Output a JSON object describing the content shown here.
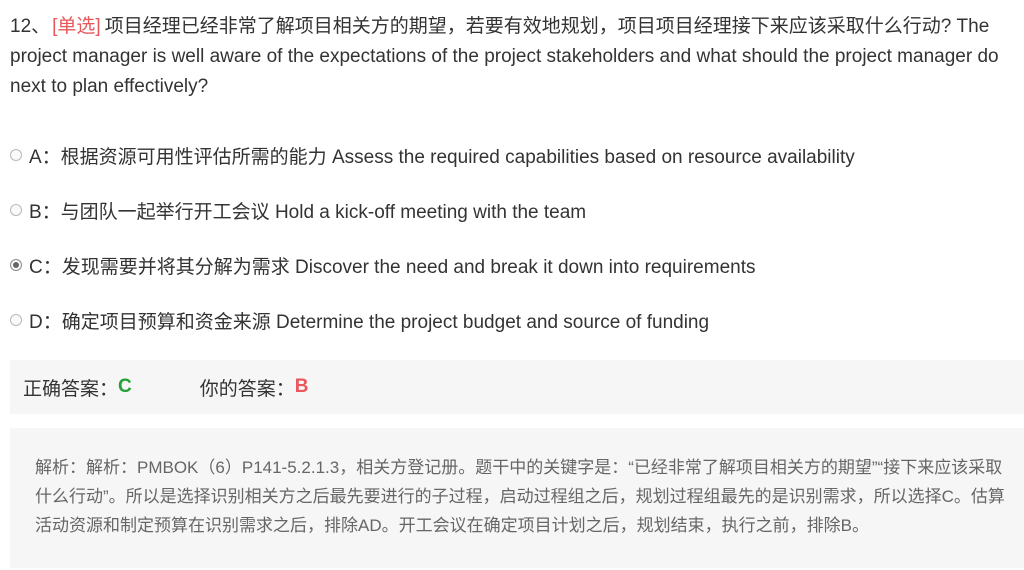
{
  "question": {
    "number": "12、",
    "type": "[单选]",
    "text": "项目经理已经非常了解项目相关方的期望，若要有效地规划，项目项目经理接下来应该采取什么行动? The project manager is well aware of the expectations of the project stakeholders and what should the project manager do next to plan effectively?"
  },
  "options": [
    {
      "label": "A：根据资源可用性评估所需的能力 Assess the required capabilities based on resource availability",
      "selected": false
    },
    {
      "label": "B：与团队一起举行开工会议 Hold a kick-off meeting with the team",
      "selected": false
    },
    {
      "label": "C：发现需要并将其分解为需求 Discover the need and break it down into requirements",
      "selected": true
    },
    {
      "label": "D：确定项目预算和资金来源 Determine the project budget and source of funding",
      "selected": false
    }
  ],
  "answer": {
    "correct_label": "正确答案：",
    "correct_value": "C",
    "yours_label": "你的答案：",
    "yours_value": "B"
  },
  "analysis": {
    "text": "解析：解析：PMBOK（6）P141-5.2.1.3，相关方登记册。题干中的关键字是：“已经非常了解项目相关方的期望”“接下来应该采取什么行动”。所以是选择识别相关方之后最先要进行的子过程，启动过程组之后，规划过程组最先的是识别需求，所以选择C。估算活动资源和制定预算在识别需求之后，排除AD。开工会议在确定项目计划之后，规划结束，执行之前，排除B。"
  },
  "colors": {
    "type_tag": "#e8575a",
    "correct": "#23a036",
    "wrong": "#e8575a",
    "panel_bg": "#f6f6f6"
  }
}
